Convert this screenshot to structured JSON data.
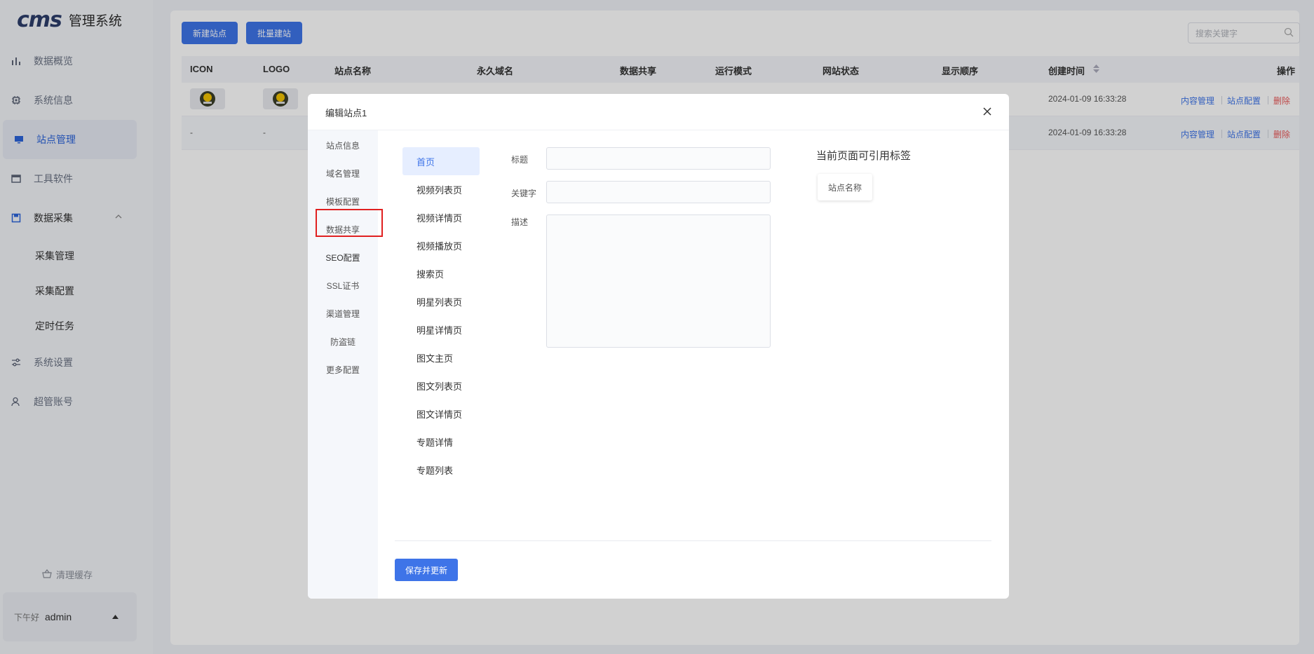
{
  "app": {
    "logo_mark": "cms",
    "title": "管理系统"
  },
  "sidebar": {
    "items": [
      {
        "label": "数据概览",
        "icon": "bar-chart-icon"
      },
      {
        "label": "系统信息",
        "icon": "chip-icon"
      },
      {
        "label": "站点管理",
        "icon": "monitor-icon"
      },
      {
        "label": "工具软件",
        "icon": "window-icon"
      },
      {
        "label": "数据采集",
        "icon": "save-icon"
      },
      {
        "label": "系统设置",
        "icon": "sliders-icon"
      },
      {
        "label": "超管账号",
        "icon": "user-icon"
      }
    ],
    "sub_items": [
      "采集管理",
      "采集配置",
      "定时任务"
    ],
    "clear_cache": "清理缓存",
    "greeting": "下午好",
    "username": "admin"
  },
  "toolbar": {
    "new_site": "新建站点",
    "batch_site": "批量建站",
    "search_placeholder": "搜索关键字"
  },
  "table": {
    "headers": [
      "ICON",
      "LOGO",
      "站点名称",
      "永久域名",
      "数据共享",
      "运行模式",
      "网站状态",
      "显示顺序",
      "创建时间",
      "操作"
    ],
    "rows": [
      {
        "icon": "",
        "logo": "",
        "created": "2024-01-09 16:33:28"
      },
      {
        "icon": "-",
        "logo": "-",
        "created": "2024-01-09 16:33:28"
      }
    ],
    "ops": {
      "content": "内容管理",
      "config": "站点配置",
      "delete": "删除"
    }
  },
  "dialog": {
    "title": "编辑站点1",
    "tabs": [
      "站点信息",
      "域名管理",
      "模板配置",
      "数据共享",
      "SEO配置",
      "SSL证书",
      "渠道管理",
      "防盗链",
      "更多配置"
    ],
    "pages": [
      "首页",
      "视频列表页",
      "视频详情页",
      "视频播放页",
      "搜索页",
      "明星列表页",
      "明星详情页",
      "图文主页",
      "图文列表页",
      "图文详情页",
      "专题详情",
      "专题列表"
    ],
    "fields": {
      "title_label": "标题",
      "keywords_label": "关键字",
      "desc_label": "描述"
    },
    "tags_title": "当前页面可引用标签",
    "tag": "站点名称",
    "save": "保存并更新"
  },
  "colors": {
    "primary": "#3e74e8",
    "danger": "#e85858",
    "highlight": "#e02020"
  }
}
